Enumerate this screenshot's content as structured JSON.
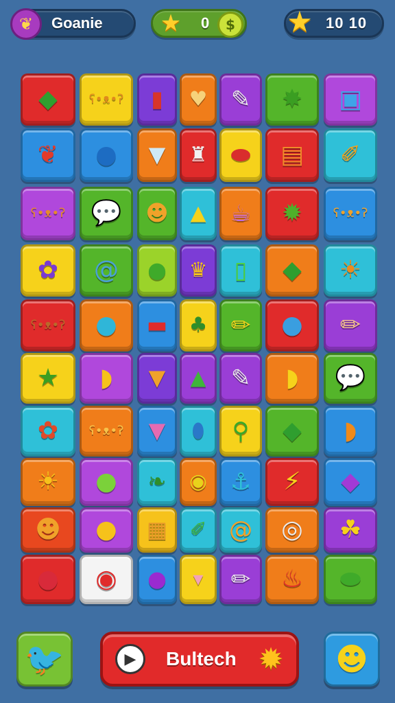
{
  "hud": {
    "title": "Goanie",
    "title_icon": "leaf-icon",
    "score": "0",
    "score_icon": "star-icon",
    "coin_icon": "coin-icon",
    "moves": "10 10",
    "moves_icon": "star-icon"
  },
  "board": {
    "rows": [
      [
        {
          "color": "#e02b2b",
          "icon": "green-gem-icon",
          "glyph": "◆",
          "glyph_color": "#2f9e2f"
        },
        {
          "color": "#f6d21b",
          "icon": "bear-face-icon",
          "glyph": "ʕ•ᴥ•ʔ",
          "glyph_color": "#e08a1c",
          "small": true
        },
        {
          "color": "#7c3cd6",
          "icon": "paint-jar-icon",
          "glyph": "▮",
          "glyph_color": "#d8352a"
        },
        {
          "color": "#f07d1a",
          "icon": "heart-cone-icon",
          "glyph": "♥",
          "glyph_color": "#f6d27a"
        },
        {
          "color": "#9a3ed6",
          "icon": "paint-tube-icon",
          "glyph": "✎",
          "glyph_color": "#eaeaea"
        },
        {
          "color": "#54b52a",
          "icon": "green-star-face-icon",
          "glyph": "✸",
          "glyph_color": "#3a9e22"
        },
        {
          "color": "#b048dc",
          "icon": "robot-icon",
          "glyph": "▣",
          "glyph_color": "#3fa4e8"
        }
      ],
      [
        {
          "color": "#2d8fe0",
          "icon": "strawberry-icon",
          "glyph": "❦",
          "glyph_color": "#e23a2a"
        },
        {
          "color": "#2d8fe0",
          "icon": "blue-bird-icon",
          "glyph": "●",
          "glyph_color": "#1d6cc2"
        },
        {
          "color": "#f07d1a",
          "icon": "ice-cream-icon",
          "glyph": "▼",
          "glyph_color": "#cfe9f5"
        },
        {
          "color": "#e02b2b",
          "icon": "toy-robot-icon",
          "glyph": "♜",
          "glyph_color": "#f2f2f2"
        },
        {
          "color": "#f6d21b",
          "icon": "red-capsule-icon",
          "glyph": "⬬",
          "glyph_color": "#d92d2d"
        },
        {
          "color": "#e02b2b",
          "icon": "orange-bag-icon",
          "glyph": "▤",
          "glyph_color": "#f08a2a"
        },
        {
          "color": "#2fc0d8",
          "icon": "pencil-icon",
          "glyph": "✐",
          "glyph_color": "#f3a21b"
        }
      ],
      [
        {
          "color": "#b048dc",
          "icon": "bear-face-icon",
          "glyph": "ʕ•ᴥ•ʔ",
          "glyph_color": "#e58a2c",
          "small": true
        },
        {
          "color": "#54b52a",
          "icon": "speech-bubble-icon",
          "glyph": "💬",
          "glyph_color": "#ffffff"
        },
        {
          "color": "#54b52a",
          "icon": "orange-creature-icon",
          "glyph": "☻",
          "glyph_color": "#f0a22a"
        },
        {
          "color": "#2fc0d8",
          "icon": "paint-bottle-icon",
          "glyph": "▲",
          "glyph_color": "#f6d21b"
        },
        {
          "color": "#f07d1a",
          "icon": "striped-cup-icon",
          "glyph": "☕",
          "glyph_color": "#c36be0"
        },
        {
          "color": "#e02b2b",
          "icon": "green-monster-icon",
          "glyph": "✹",
          "glyph_color": "#4fb02a"
        },
        {
          "color": "#2d8fe0",
          "icon": "bear-face-icon",
          "glyph": "ʕ•ᴥ•ʔ",
          "glyph_color": "#f0a22a",
          "small": true
        }
      ],
      [
        {
          "color": "#f6d21b",
          "icon": "purple-flower-icon",
          "glyph": "✿",
          "glyph_color": "#7a3ad2"
        },
        {
          "color": "#54b52a",
          "icon": "swirl-lollipop-icon",
          "glyph": "@",
          "glyph_color": "#4aa1d6"
        },
        {
          "color": "#9bd32a",
          "icon": "green-balloon-icon",
          "glyph": "●",
          "glyph_color": "#3faa2a"
        },
        {
          "color": "#7c3cd6",
          "icon": "paint-pot-icon",
          "glyph": "♛",
          "glyph_color": "#f6c21b"
        },
        {
          "color": "#2fc0d8",
          "icon": "battery-icon",
          "glyph": "▯",
          "glyph_color": "#4fd13a"
        },
        {
          "color": "#f07d1a",
          "icon": "green-gem-icon",
          "glyph": "◆",
          "glyph_color": "#2f9e2f"
        },
        {
          "color": "#2fc0d8",
          "icon": "sun-face-icon",
          "glyph": "☀",
          "glyph_color": "#f08a1a"
        }
      ],
      [
        {
          "color": "#e02b2b",
          "icon": "bear-face-icon",
          "glyph": "ʕ•ᴥ•ʔ",
          "glyph_color": "#b96a2a",
          "small": true
        },
        {
          "color": "#f07d1a",
          "icon": "red-bird-icon",
          "glyph": "●",
          "glyph_color": "#2fb6d8"
        },
        {
          "color": "#2d8fe0",
          "icon": "red-box-icon",
          "glyph": "▬",
          "glyph_color": "#e02b2b"
        },
        {
          "color": "#f6d21b",
          "icon": "plant-pot-icon",
          "glyph": "♣",
          "glyph_color": "#2f8e2a"
        },
        {
          "color": "#54b52a",
          "icon": "crayon-icon",
          "glyph": "✏",
          "glyph_color": "#f6d21b"
        },
        {
          "color": "#e02b2b",
          "icon": "blue-blob-face-icon",
          "glyph": "●",
          "glyph_color": "#3a9ee0"
        },
        {
          "color": "#9a3ed6",
          "icon": "crayon-icon",
          "glyph": "✏",
          "glyph_color": "#f3c28a"
        }
      ],
      [
        {
          "color": "#f6d21b",
          "icon": "green-star-face-icon",
          "glyph": "★",
          "glyph_color": "#3a9e22"
        },
        {
          "color": "#b048dc",
          "icon": "yellow-fish-icon",
          "glyph": "◗",
          "glyph_color": "#f6c21b"
        },
        {
          "color": "#7c3cd6",
          "icon": "ice-cream-cone-icon",
          "glyph": "▼",
          "glyph_color": "#f0a22a"
        },
        {
          "color": "#9a3ed6",
          "icon": "green-bottle-icon",
          "glyph": "▲",
          "glyph_color": "#3fb53a"
        },
        {
          "color": "#9a3ed6",
          "icon": "paint-tube-icon",
          "glyph": "✎",
          "glyph_color": "#eaeaea"
        },
        {
          "color": "#f07d1a",
          "icon": "yellow-bird-icon",
          "glyph": "◗",
          "glyph_color": "#f6d21b"
        },
        {
          "color": "#54b52a",
          "icon": "speech-bubble-icon",
          "glyph": "💬",
          "glyph_color": "#ffffff"
        }
      ],
      [
        {
          "color": "#2fc0d8",
          "icon": "purple-flower-icon",
          "glyph": "✿",
          "glyph_color": "#e04a2a"
        },
        {
          "color": "#f07d1a",
          "icon": "bear-face-icon",
          "glyph": "ʕ•ᴥ•ʔ",
          "glyph_color": "#f6c24a",
          "small": true
        },
        {
          "color": "#2d8fe0",
          "icon": "pink-cone-icon",
          "glyph": "▼",
          "glyph_color": "#e46bb2"
        },
        {
          "color": "#2fc0d8",
          "icon": "blue-bottle-icon",
          "glyph": "⬮",
          "glyph_color": "#2a78c8"
        },
        {
          "color": "#f6d21b",
          "icon": "green-wand-icon",
          "glyph": "⚲",
          "glyph_color": "#3aa82a"
        },
        {
          "color": "#54b52a",
          "icon": "green-gem-icon",
          "glyph": "◆",
          "glyph_color": "#2f9e2f"
        },
        {
          "color": "#2d8fe0",
          "icon": "orange-fish-icon",
          "glyph": "◗",
          "glyph_color": "#f08a1a"
        }
      ],
      [
        {
          "color": "#f07d1a",
          "icon": "sun-face-icon",
          "glyph": "☀",
          "glyph_color": "#f6c21b"
        },
        {
          "color": "#b048dc",
          "icon": "green-lemon-icon",
          "glyph": "●",
          "glyph_color": "#7bd13a"
        },
        {
          "color": "#2fc0d8",
          "icon": "green-leaf-icon",
          "glyph": "❧",
          "glyph_color": "#2f8e2a"
        },
        {
          "color": "#f07d1a",
          "icon": "tennis-ball-icon",
          "glyph": "◉",
          "glyph_color": "#e8d21b"
        },
        {
          "color": "#2d8fe0",
          "icon": "fishing-rod-icon",
          "glyph": "⚓",
          "glyph_color": "#2fc0d8"
        },
        {
          "color": "#e02b2b",
          "icon": "lightning-icon",
          "glyph": "⚡",
          "glyph_color": "#f6d21b"
        },
        {
          "color": "#2d8fe0",
          "icon": "purple-shell-icon",
          "glyph": "◆",
          "glyph_color": "#a23ad6"
        }
      ],
      [
        {
          "color": "#e8481f",
          "icon": "pineapple-face-icon",
          "glyph": "☻",
          "glyph_color": "#f0a22a"
        },
        {
          "color": "#b048dc",
          "icon": "mango-icon",
          "glyph": "●",
          "glyph_color": "#f6c21b"
        },
        {
          "color": "#f6c21b",
          "icon": "cookie-box-icon",
          "glyph": "▦",
          "glyph_color": "#e89a2a"
        },
        {
          "color": "#2fc0d8",
          "icon": "green-brush-icon",
          "glyph": "✐",
          "glyph_color": "#3fb53a"
        },
        {
          "color": "#2fc0d8",
          "icon": "swirl-lollipop-icon",
          "glyph": "@",
          "glyph_color": "#f0a22a"
        },
        {
          "color": "#f07d1a",
          "icon": "camera-icon",
          "glyph": "◎",
          "glyph_color": "#eaeaea"
        },
        {
          "color": "#9a3ed6",
          "icon": "banana-bunch-icon",
          "glyph": "☘",
          "glyph_color": "#f6d21b"
        }
      ],
      [
        {
          "color": "#e02b2b",
          "icon": "red-berry-icon",
          "glyph": "●",
          "glyph_color": "#d82a3a"
        },
        {
          "color": "#f4f4f4",
          "icon": "red-ball-icon",
          "glyph": "◉",
          "glyph_color": "#e02b2b"
        },
        {
          "color": "#2d8fe0",
          "icon": "eggplant-icon",
          "glyph": "●",
          "glyph_color": "#9a2ad0"
        },
        {
          "color": "#f6d21b",
          "icon": "pink-cup-icon",
          "glyph": "▾",
          "glyph_color": "#f3a2b8"
        },
        {
          "color": "#9a3ed6",
          "icon": "crayon-icon",
          "glyph": "✏",
          "glyph_color": "#eaeaea"
        },
        {
          "color": "#f07d1a",
          "icon": "red-chili-icon",
          "glyph": "♨",
          "glyph_color": "#e02b2b"
        },
        {
          "color": "#54b52a",
          "icon": "green-gem-icon",
          "glyph": "⬬",
          "glyph_color": "#3faa2a"
        }
      ]
    ]
  },
  "footer": {
    "left_icon": "white-bird-icon",
    "play_icon": "play-icon",
    "main_label": "Bultech",
    "gear_icon": "gear-icon",
    "right_icon": "bee-face-icon"
  }
}
